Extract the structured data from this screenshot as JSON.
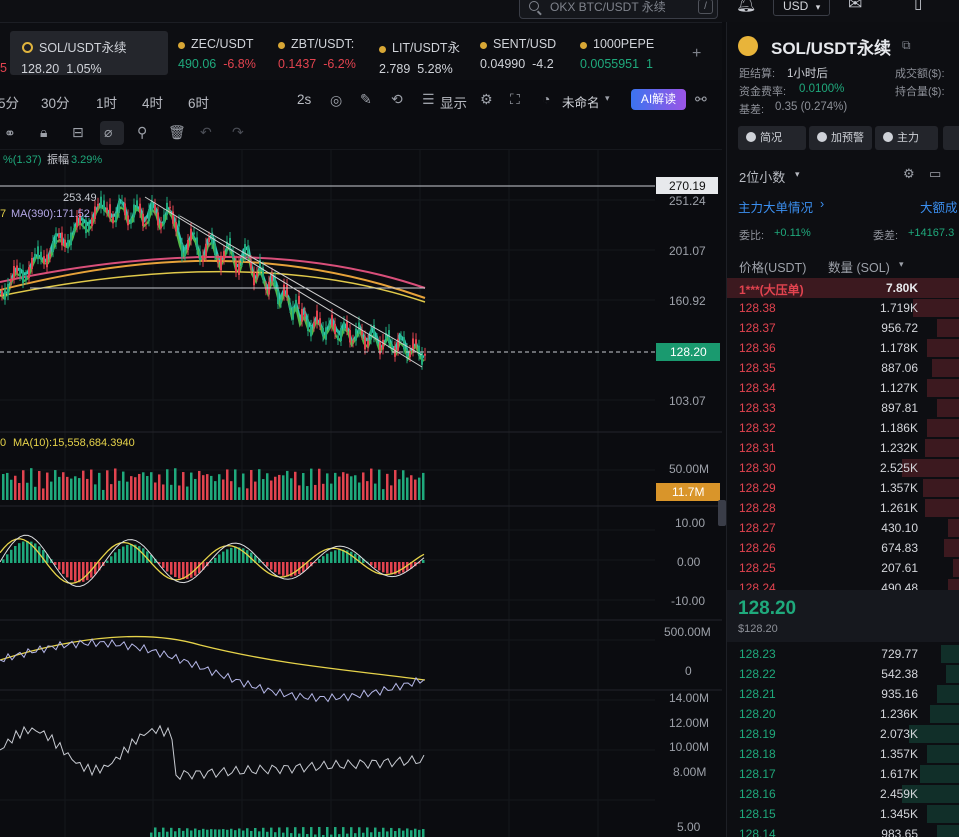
{
  "search": {
    "placeholder": "OKX BTC/USDT 永续",
    "shortcut": "/"
  },
  "currency": {
    "selected": "USD"
  },
  "tickers": [
    {
      "symbol": "SOL/USDT永续",
      "price": "128.20",
      "change": "1.05%",
      "dir": "up",
      "active": true
    },
    {
      "symbol": "ZEC/USDT",
      "price": "490.06",
      "change": "-6.8%",
      "dir": "down"
    },
    {
      "symbol": "ZBT/USDT:",
      "price": "0.1437",
      "change": "-6.2%",
      "dir": "down"
    },
    {
      "symbol": "LIT/USDT永",
      "price": "2.789",
      "change": "5.28%",
      "dir": "up"
    },
    {
      "symbol": "SENT/USD",
      "price": "0.04990",
      "change": "-4.2",
      "dir": "down"
    },
    {
      "symbol": "1000PEPE",
      "price": "0.0055951",
      "change": "1",
      "dir": "up"
    }
  ],
  "prev_ticker_fragment": "5",
  "add_tab": "+",
  "timeframes": [
    "5分",
    "30分",
    "1时",
    "4时",
    "6时"
  ],
  "toolbar": {
    "interval": "2s",
    "display": "显示",
    "layout_name": "未命名",
    "ai": "AI解读"
  },
  "chart_info": {
    "stats_prefix": "%(1.37)",
    "amplitude_label": "振幅",
    "amplitude": "3.29%",
    "ma_label": "MA(390):171.52",
    "ma_prefix": "7",
    "high_label": "253.49",
    "vol_ma_label": "MA(10):15,558,684.3940",
    "vol_prefix": "0",
    "price_axis": [
      "251.24",
      "201.07",
      "160.92",
      "103.07"
    ],
    "current_price": "128.20",
    "top_line_price": "270.19",
    "volume_axis": [
      "50.00M"
    ],
    "volume_current": "11.7M",
    "macd_axis": [
      "10.00",
      "0.00",
      "-10.00"
    ],
    "obv_axis": [
      "500.00M",
      "0"
    ],
    "last_axis": [
      "14.00M",
      "12.00M",
      "10.00M",
      "8.00M",
      "5.00"
    ]
  },
  "colors": {
    "up": "#1fa97c",
    "down": "#e2434f",
    "accent": "#3b74f0",
    "ma_yellow": "#e6d34a"
  },
  "right_panel": {
    "title": "SOL/USDT永续",
    "funding_countdown_label": "距结算:",
    "funding_countdown": "1小时后",
    "volume_label": "成交额($):",
    "funding_rate_label": "资金费率:",
    "funding_rate": "0.0100%",
    "oi_label": "持合量($):",
    "basis_label": "基差:",
    "basis": "0.35 (0.274%)",
    "buttons": [
      "简况",
      "加预警",
      "主力"
    ],
    "precision": "2位小数",
    "big_orders": "主力大单情况",
    "big_deals": "大额成",
    "ratio_label": "委比:",
    "ratio": "+0.11%",
    "diff_label": "委差:",
    "diff": "+14167.3",
    "price_header": "价格(USDT)",
    "qty_header": "数量 (SOL)",
    "big_ask_label": "1***(大压单)",
    "big_ask_qty": "7.80K",
    "asks": [
      {
        "price": "128.38",
        "qty": "1.719K",
        "bar": 0.2
      },
      {
        "price": "128.37",
        "qty": "956.72",
        "bar": 0.1
      },
      {
        "price": "128.36",
        "qty": "1.178K",
        "bar": 0.14
      },
      {
        "price": "128.35",
        "qty": "887.06",
        "bar": 0.12
      },
      {
        "price": "128.34",
        "qty": "1.127K",
        "bar": 0.14
      },
      {
        "price": "128.33",
        "qty": "897.81",
        "bar": 0.1
      },
      {
        "price": "128.32",
        "qty": "1.186K",
        "bar": 0.14
      },
      {
        "price": "128.31",
        "qty": "1.232K",
        "bar": 0.15
      },
      {
        "price": "128.30",
        "qty": "2.525K",
        "bar": 0.25
      },
      {
        "price": "128.29",
        "qty": "1.357K",
        "bar": 0.16
      },
      {
        "price": "128.28",
        "qty": "1.261K",
        "bar": 0.15
      },
      {
        "price": "128.27",
        "qty": "430.10",
        "bar": 0.05
      },
      {
        "price": "128.26",
        "qty": "674.83",
        "bar": 0.07
      },
      {
        "price": "128.25",
        "qty": "207.61",
        "bar": 0.03
      },
      {
        "price": "128.24",
        "qty": "490.48",
        "bar": 0.05
      }
    ],
    "last_price": "128.20",
    "last_price_usd": "$128.20",
    "bids": [
      {
        "price": "128.23",
        "qty": "729.77",
        "bar": 0.08
      },
      {
        "price": "128.22",
        "qty": "542.38",
        "bar": 0.06
      },
      {
        "price": "128.21",
        "qty": "935.16",
        "bar": 0.1
      },
      {
        "price": "128.20",
        "qty": "1.236K",
        "bar": 0.13
      },
      {
        "price": "128.19",
        "qty": "2.073K",
        "bar": 0.22
      },
      {
        "price": "128.18",
        "qty": "1.357K",
        "bar": 0.14
      },
      {
        "price": "128.17",
        "qty": "1.617K",
        "bar": 0.17
      },
      {
        "price": "128.16",
        "qty": "2.459K",
        "bar": 0.25
      },
      {
        "price": "128.15",
        "qty": "1.345K",
        "bar": 0.14
      },
      {
        "price": "128.14",
        "qty": "983.65",
        "bar": 0.1
      }
    ]
  }
}
